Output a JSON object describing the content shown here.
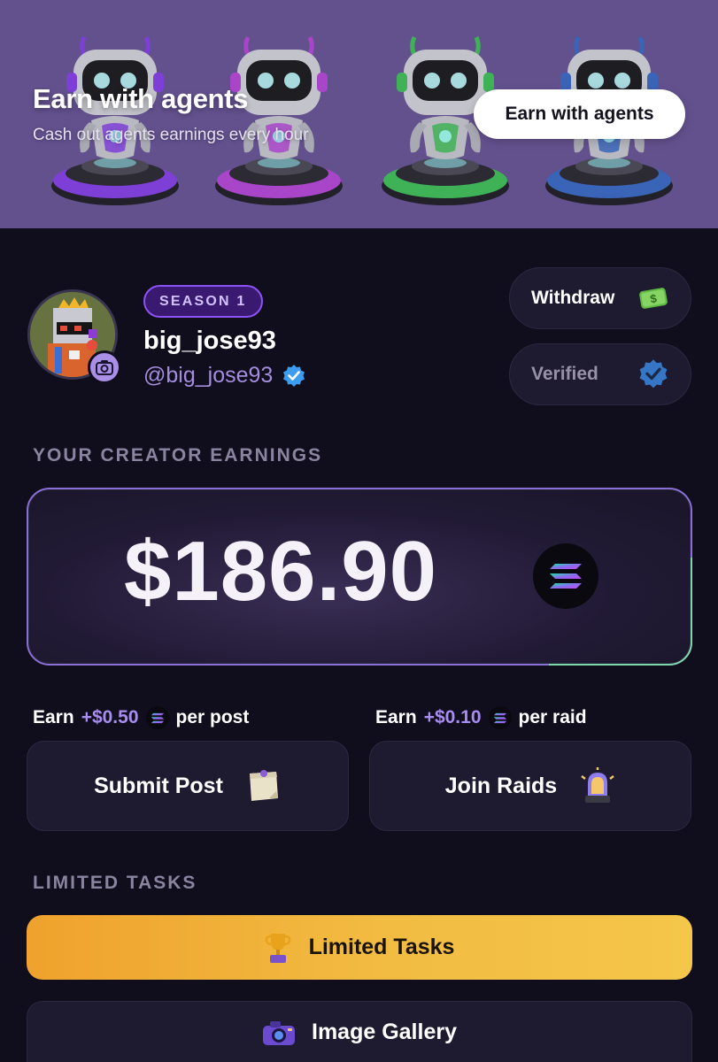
{
  "banner": {
    "title": "Earn with agents",
    "subtitle": "Cash out agents earnings every hour",
    "button_label": "Earn with agents",
    "robot_colors": [
      "#7d3fd6",
      "#a845c9",
      "#3fb257",
      "#3a64b8"
    ]
  },
  "profile": {
    "season_badge": "SEASON 1",
    "username": "big_jose93",
    "handle": "@big_jose93",
    "verified_icon": "verified-check-icon",
    "camera_icon": "camera-icon"
  },
  "side_buttons": {
    "withdraw_label": "Withdraw",
    "withdraw_icon": "money-icon",
    "verified_label": "Verified",
    "verified_icon": "verified-badge-icon"
  },
  "earnings": {
    "section_label": "YOUR CREATOR EARNINGS",
    "amount": "$186.90",
    "currency_icon": "solana-icon"
  },
  "post": {
    "earn_prefix": "Earn",
    "amount": "+$0.50",
    "suffix": "per post",
    "button_label": "Submit Post",
    "icon": "sticky-note-icon"
  },
  "raid": {
    "earn_prefix": "Earn",
    "amount": "+$0.10",
    "suffix": "per raid",
    "button_label": "Join Raids",
    "icon": "siren-icon"
  },
  "limited": {
    "section_label": "LIMITED TASKS",
    "button_label": "Limited Tasks",
    "icon": "trophy-icon",
    "color": "#f2bc42"
  },
  "gallery": {
    "button_label": "Image Gallery",
    "icon": "camera-icon"
  },
  "colors": {
    "background": "#100d1d",
    "banner": "#63518e",
    "accent": "#a88df0",
    "card": "#1e1a30"
  }
}
